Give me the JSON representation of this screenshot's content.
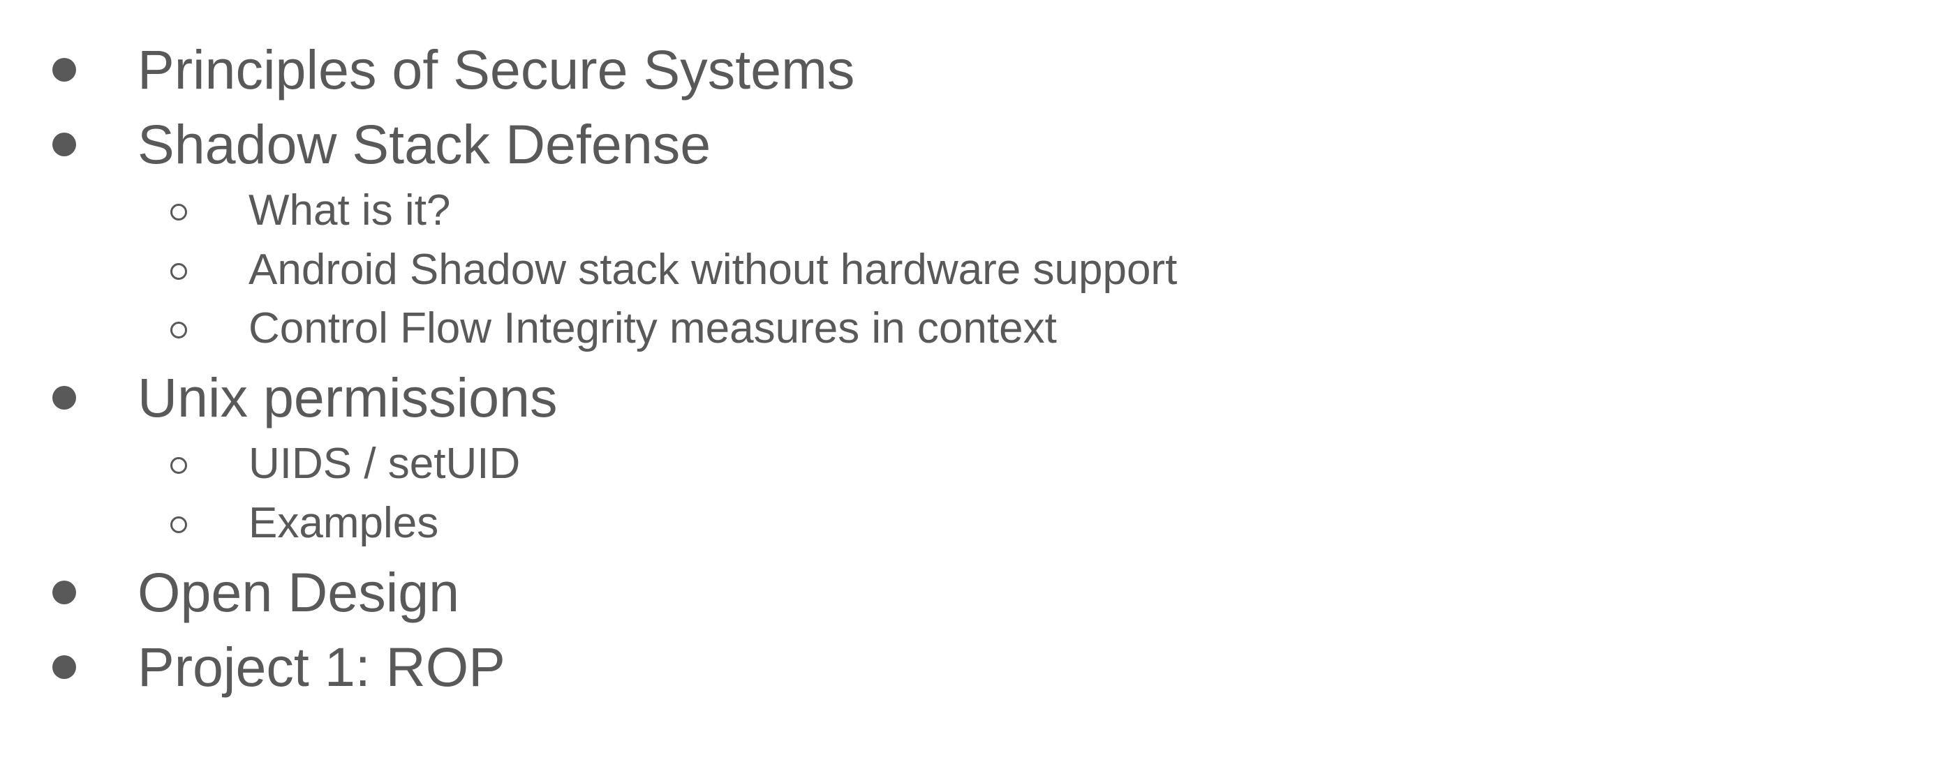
{
  "outline": {
    "items": [
      {
        "label": "Principles of Secure Systems"
      },
      {
        "label": "Shadow Stack Defense",
        "children": [
          {
            "label": "What is it?"
          },
          {
            "label": "Android Shadow stack without hardware support"
          },
          {
            "label": "Control Flow Integrity measures in context"
          }
        ]
      },
      {
        "label": "Unix permissions",
        "children": [
          {
            "label": "UIDS / setUID"
          },
          {
            "label": "Examples"
          }
        ]
      },
      {
        "label": "Open Design"
      },
      {
        "label": "Project 1: ROP"
      }
    ]
  },
  "colors": {
    "text": "#595959",
    "background": "#ffffff"
  },
  "icons": {
    "level1": "filled-circle-bullet-icon",
    "level2": "hollow-circle-bullet-icon"
  }
}
